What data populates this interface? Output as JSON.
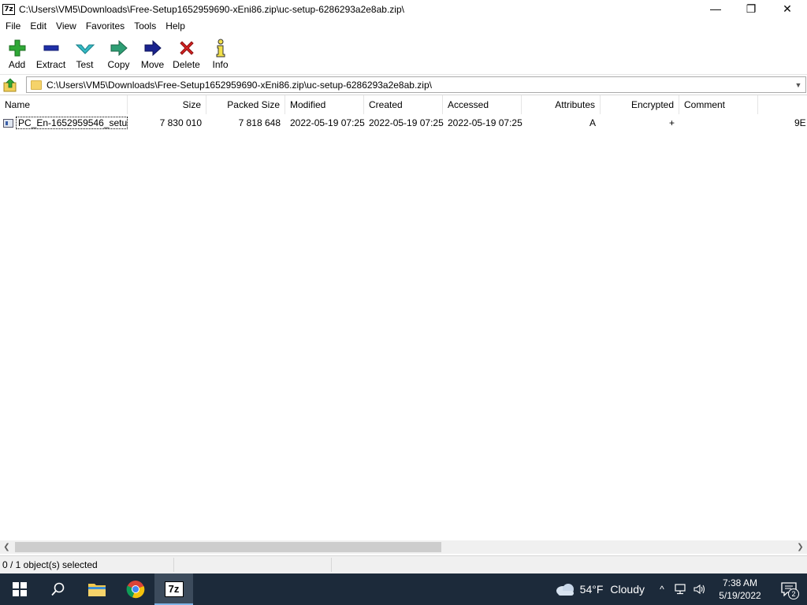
{
  "window": {
    "app_icon_text": "7z",
    "title": "C:\\Users\\VM5\\Downloads\\Free-Setup1652959690-xEni86.zip\\uc-setup-6286293a2e8ab.zip\\",
    "minimize": "—",
    "maximize": "❐",
    "close": "✕"
  },
  "menu": [
    "File",
    "Edit",
    "View",
    "Favorites",
    "Tools",
    "Help"
  ],
  "toolbar": {
    "add": "Add",
    "extract": "Extract",
    "test": "Test",
    "copy": "Copy",
    "move": "Move",
    "delete": "Delete",
    "info": "Info"
  },
  "address": {
    "path": "C:\\Users\\VM5\\Downloads\\Free-Setup1652959690-xEni86.zip\\uc-setup-6286293a2e8ab.zip\\"
  },
  "columns": {
    "name": "Name",
    "size": "Size",
    "packed_size": "Packed Size",
    "modified": "Modified",
    "created": "Created",
    "accessed": "Accessed",
    "attributes": "Attributes",
    "encrypted": "Encrypted",
    "comment": "Comment"
  },
  "rows": [
    {
      "name": "PC_En-1652959546_setu...",
      "size": "7 830 010",
      "packed_size": "7 818 648",
      "modified": "2022-05-19 07:25",
      "created": "2022-05-19 07:25",
      "accessed": "2022-05-19 07:25",
      "attributes": "A",
      "encrypted": "+",
      "comment": "",
      "extra": "9E"
    }
  ],
  "status": {
    "selection": "0 / 1 object(s) selected"
  },
  "taskbar": {
    "weather_temp": "54°F",
    "weather_cond": "Cloudy",
    "time": "7:38 AM",
    "date": "5/19/2022",
    "notifications": "2",
    "active_app_label": "7z"
  },
  "colors": {
    "taskbar_bg": "#1c2a3a",
    "add_green": "#2fa836",
    "extract_blue": "#1f2fa8",
    "test_teal": "#34b9c4",
    "copy_green": "#2e9e74",
    "move_navy": "#1a238f",
    "delete_red": "#d52222"
  }
}
